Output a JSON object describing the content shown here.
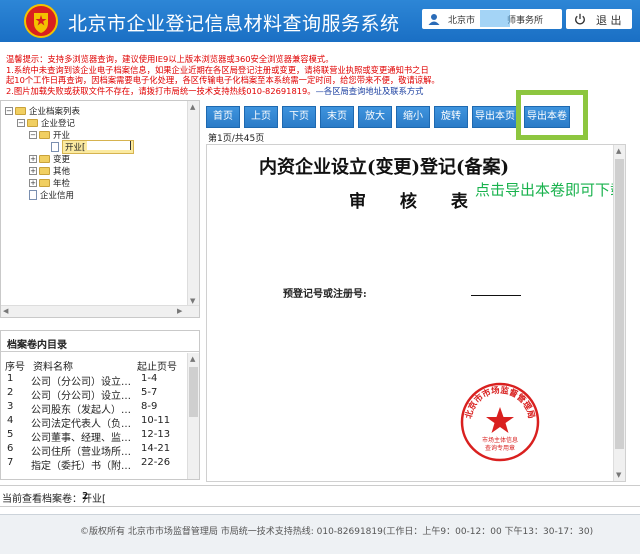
{
  "header": {
    "title": "北京市企业登记信息材料查询服务系统",
    "user_label": "北京市",
    "user_dept": "师事务所",
    "logout_label": "退 出"
  },
  "notice": {
    "line1": "温馨提示：支持多浏览器查询，建议使用IE9以上版本浏览器或360安全浏览器兼容模式。",
    "line2": "1.系统中未查询到该企业电子档案信息，如果企业近期在各区局登记注册或变更，请将联营业执照或变更通知书之日",
    "line3": "起10个工作日再查询，因档案需要电子化处理，各区传输电子化档案至本系统需一定时间，给您带来不便，敬请谅解。",
    "line4": "2.图片加载失败或获取文件不存在，请拨打市局统一技术支持热线010-82691819。",
    "line4_blue": "—各区局查询地址及联系方式"
  },
  "tree": {
    "root": "企业档案列表",
    "reg": "企业登记",
    "open": "开业",
    "open_child": "开业[",
    "change": "变更",
    "other": "其他",
    "annual": "年检",
    "credit": "企业信用"
  },
  "catalog": {
    "title": "档案卷内目录",
    "headers": {
      "no": "序号",
      "name": "资料名称",
      "page": "起止页号"
    },
    "rows": [
      {
        "no": "1",
        "name": "公司（分公司）设立…",
        "page": "1-4"
      },
      {
        "no": "2",
        "name": "公司（分公司）设立…",
        "page": "5-7"
      },
      {
        "no": "3",
        "name": "公司股东（发起人）…",
        "page": "8-9"
      },
      {
        "no": "4",
        "name": "公司法定代表人（负…",
        "page": "10-11"
      },
      {
        "no": "5",
        "name": "公司董事、经理、监…",
        "page": "12-13"
      },
      {
        "no": "6",
        "name": "公司住所（营业场所…",
        "page": "14-21"
      },
      {
        "no": "7",
        "name": "指定（委托）书（附…",
        "page": "22-26"
      }
    ]
  },
  "toolbar": {
    "first": "首页",
    "prev": "上页",
    "next": "下页",
    "last": "末页",
    "zoom_in": "放大",
    "zoom_out": "缩小",
    "rotate": "旋转",
    "export_page": "导出本页",
    "export_volume": "导出本卷"
  },
  "page_info": "第1页/共45页",
  "document": {
    "title": "内资企业设立(变更)登记(备案)",
    "subtitle": "审 核 表",
    "reg_label": "预登记号或注册号:",
    "seal_text": "北京市市场监督管理局",
    "seal_sub1": "市场主体信息",
    "seal_sub2": "查询专用章"
  },
  "annotation": "点击导出本卷即可下载",
  "status": {
    "current_label": "当前查看档案卷：开业[",
    "current_value": "2"
  },
  "footer": {
    "text": "©版权所有 北京市市场监督管理局  市局统一技术支持热线: 010-82691819(工作日：上午9：00-12：00 下午13：30-17：30)"
  },
  "colors": {
    "header_blue": "#1a6fc4",
    "button_blue": "#2a7bc7",
    "notice_red": "#e00000",
    "highlight_green": "#8dc63f",
    "annotation_green": "#19b24d",
    "seal_red": "#d9201f"
  }
}
